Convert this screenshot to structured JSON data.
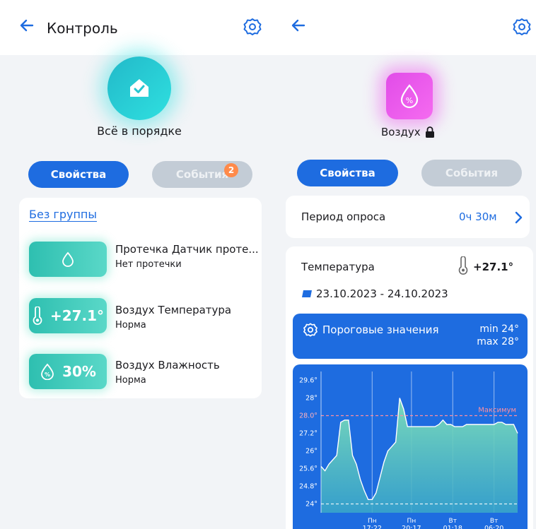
{
  "left": {
    "title": "Контроль",
    "status": "Всё в порядке",
    "tabs": {
      "properties": "Свойства",
      "events": "События",
      "events_badge": "2"
    },
    "group_label": "Без группы",
    "devices": [
      {
        "tile_value": "",
        "name": "Протечка Датчик проте...",
        "state": "Нет протечки",
        "icon": "drop-icon"
      },
      {
        "tile_value": "+27.1°",
        "name": "Воздух Температура",
        "state": "Норма",
        "icon": "thermometer-icon"
      },
      {
        "tile_value": "30%",
        "name": "Воздух Влажность",
        "state": "Норма",
        "icon": "humidity-icon"
      }
    ]
  },
  "right": {
    "device_name": "Воздух",
    "tabs": {
      "properties": "Свойства",
      "events": "События"
    },
    "poll_label": "Период опроса",
    "poll_value": "0ч 30м",
    "temp_label": "Температура",
    "temp_value": "+27.1°",
    "date_range": "23.10.2023 - 24.10.2023",
    "threshold_label": "Пороговые значения",
    "threshold_min": "min 24°",
    "threshold_max": "max 28°"
  },
  "colors": {
    "accent": "#1e6ce0",
    "ok": "#2fe0e0",
    "humidity": "#e14ce8",
    "badge": "#ff8a4a"
  },
  "chart_data": {
    "type": "area",
    "x": [
      0,
      1,
      2,
      3,
      4,
      5,
      6,
      7,
      8,
      9,
      10,
      11,
      12,
      13,
      14,
      15,
      16,
      17,
      18,
      19,
      20,
      21,
      22,
      23,
      24,
      25,
      26,
      27,
      28,
      29,
      30,
      31,
      32,
      33,
      34,
      35,
      36,
      37,
      38,
      39,
      40,
      41,
      42,
      43,
      44,
      45,
      46,
      47,
      48,
      49,
      50
    ],
    "values": [
      25.7,
      25.5,
      25.8,
      26.0,
      26.2,
      27.7,
      27.8,
      27.8,
      26.2,
      25.8,
      25.1,
      24.6,
      24.2,
      24.2,
      24.5,
      25.2,
      25.9,
      26.4,
      26.6,
      26.8,
      28.8,
      28.3,
      27.5,
      27.5,
      27.5,
      27.5,
      27.5,
      27.5,
      27.5,
      27.5,
      27.6,
      27.8,
      27.6,
      27.6,
      27.5,
      27.5,
      27.5,
      27.6,
      27.6,
      27.6,
      27.6,
      27.6,
      27.6,
      27.6,
      27.6,
      27.7,
      27.7,
      27.6,
      27.6,
      27.6,
      27.2
    ],
    "y_ticks": [
      "29.6°",
      "28°",
      "28.0°",
      "27.2°",
      "26°",
      "25.6°",
      "24.8°",
      "24°"
    ],
    "y_tick_values": [
      29.6,
      28.8,
      28.0,
      27.2,
      26.4,
      25.6,
      24.8,
      24.0
    ],
    "x_ticks": [
      {
        "day": "Пн",
        "time": "17:22",
        "pos": 13
      },
      {
        "day": "Пн",
        "time": "20:17",
        "pos": 23
      },
      {
        "day": "Вт",
        "time": "01:18",
        "pos": 33.5
      },
      {
        "day": "Вт",
        "time": "06:20",
        "pos": 44
      }
    ],
    "max_line": 28.0,
    "max_label": "Максимум",
    "min_line": 24.0,
    "ylim": [
      23.6,
      30.0
    ],
    "xlim": [
      0,
      50
    ]
  }
}
